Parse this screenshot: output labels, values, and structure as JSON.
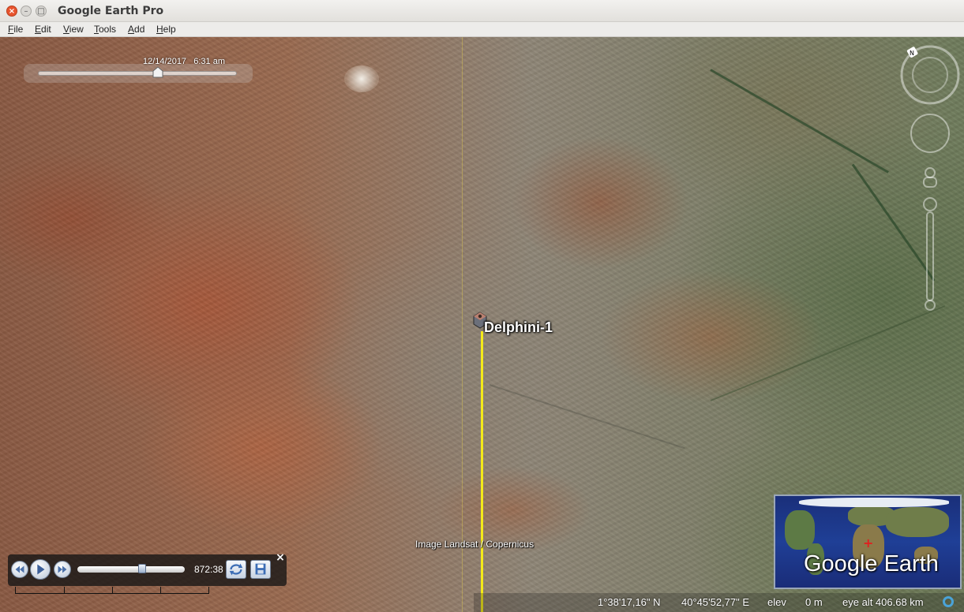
{
  "window": {
    "title": "Google Earth Pro",
    "buttons": {
      "close": "×",
      "minimize": "–",
      "maximize": "□"
    }
  },
  "menu": {
    "items": [
      "File",
      "Edit",
      "View",
      "Tools",
      "Add",
      "Help"
    ]
  },
  "time_slider": {
    "date": "12/14/2017",
    "time": "6:31 am",
    "position_fraction": 0.62
  },
  "placemark": {
    "label": "Delphini-1"
  },
  "attribution": "Image Landsat / Copernicus",
  "tour": {
    "elapsed": "872:38",
    "progress_fraction": 0.62,
    "close": "×"
  },
  "overview": {
    "brand": "Google Earth"
  },
  "status": {
    "latitude": "1°38'17,16\" N",
    "longitude": "40°45'52,77\" E",
    "elev_label": "elev",
    "elev_value": "0 m",
    "eye_alt": "eye alt 406.68 km"
  },
  "colors": {
    "track": "#f4ea1a",
    "streaming_indicator": "#4aa3d8",
    "overview_marker": "#e02020"
  },
  "icons": {
    "compass": "north-compass-icon",
    "look": "look-joystick-icon",
    "move": "move-joystick-icon",
    "zoom": "zoom-slider-icon",
    "placemark": "satellite-placemark-icon"
  }
}
